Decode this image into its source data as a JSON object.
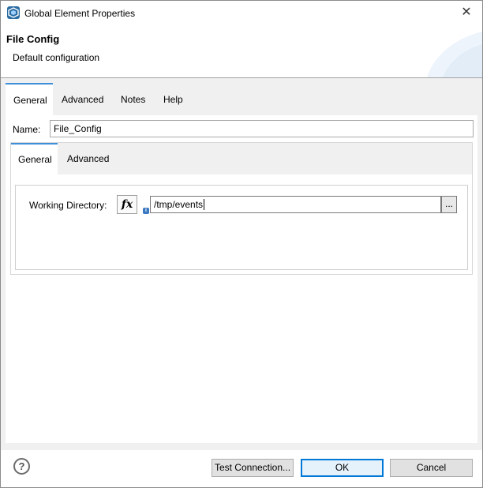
{
  "window": {
    "title": "Global Element Properties",
    "close_glyph": "✕"
  },
  "header": {
    "title": "File Config",
    "description": "Default configuration"
  },
  "tabs": [
    {
      "label": "General",
      "active": true
    },
    {
      "label": "Advanced",
      "active": false
    },
    {
      "label": "Notes",
      "active": false
    },
    {
      "label": "Help",
      "active": false
    }
  ],
  "name_field": {
    "label": "Name:",
    "value": "File_Config"
  },
  "sub_tabs": [
    {
      "label": "General",
      "active": true
    },
    {
      "label": "Advanced",
      "active": false
    }
  ],
  "working_directory": {
    "label": "Working Directory:",
    "fx_label": "fx",
    "value": "/tmp/events",
    "browse_label": "..."
  },
  "footer": {
    "help_glyph": "?",
    "test_connection_label": "Test Connection...",
    "ok_label": "OK",
    "cancel_label": "Cancel"
  },
  "colors": {
    "accent": "#3c8fd8",
    "app_icon": "#2b6da3",
    "ok_border": "#0078d7"
  }
}
